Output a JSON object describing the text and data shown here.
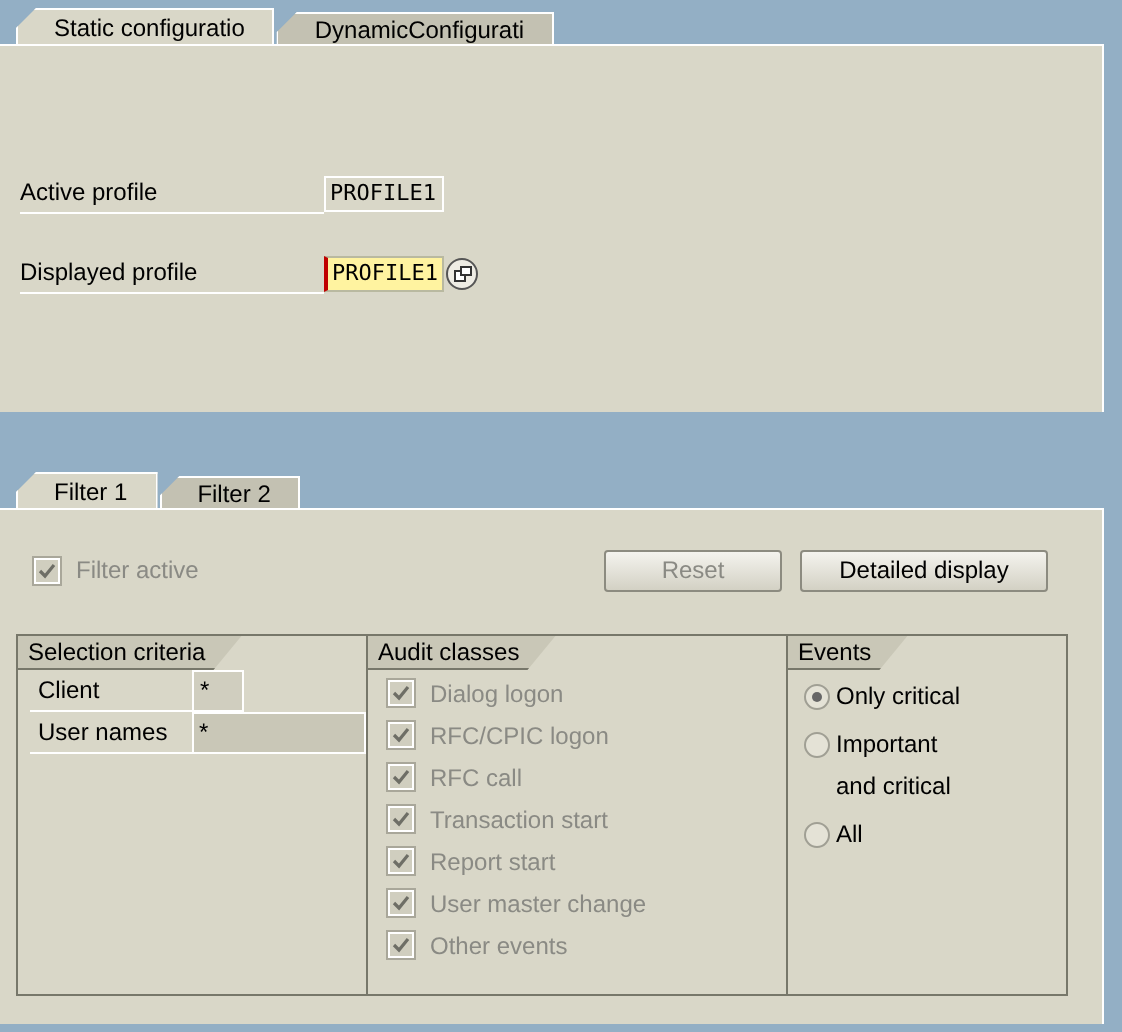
{
  "top_tabs": [
    {
      "label": "Static configuratio",
      "selected": true
    },
    {
      "label": "DynamicConfigurati",
      "selected": false
    }
  ],
  "profiles": [
    {
      "label": "Active profile",
      "value": "PROFILE1",
      "editable": false,
      "value_help": false
    },
    {
      "label": "Displayed profile",
      "value": "PROFILE1",
      "editable": true,
      "value_help": true
    }
  ],
  "filter_tabs": [
    {
      "label": "Filter 1",
      "selected": true
    },
    {
      "label": "Filter 2",
      "selected": false
    }
  ],
  "filter_active": {
    "label": "Filter active",
    "checked": true,
    "disabled": true
  },
  "buttons": [
    {
      "label": "Reset",
      "disabled": true
    },
    {
      "label": "Detailed display",
      "disabled": false
    }
  ],
  "selection_criteria": {
    "title": "Selection criteria",
    "fields": [
      {
        "label": "Client",
        "value": "*",
        "wide": false
      },
      {
        "label": "User names",
        "value": "*",
        "wide": true
      }
    ]
  },
  "audit_classes": {
    "title": "Audit classes",
    "items": [
      {
        "label": "Dialog logon",
        "checked": true,
        "disabled": true
      },
      {
        "label": "RFC/CPIC logon",
        "checked": true,
        "disabled": true
      },
      {
        "label": "RFC call",
        "checked": true,
        "disabled": true
      },
      {
        "label": "Transaction start",
        "checked": true,
        "disabled": true
      },
      {
        "label": "Report start",
        "checked": true,
        "disabled": true
      },
      {
        "label": "User master change",
        "checked": true,
        "disabled": true
      },
      {
        "label": "Other events",
        "checked": true,
        "disabled": true
      }
    ]
  },
  "events": {
    "title": "Events",
    "options": [
      {
        "label": "Only critical",
        "selected": true
      },
      {
        "label": "Important and critical",
        "selected": false
      },
      {
        "label": "All",
        "selected": false
      }
    ]
  }
}
